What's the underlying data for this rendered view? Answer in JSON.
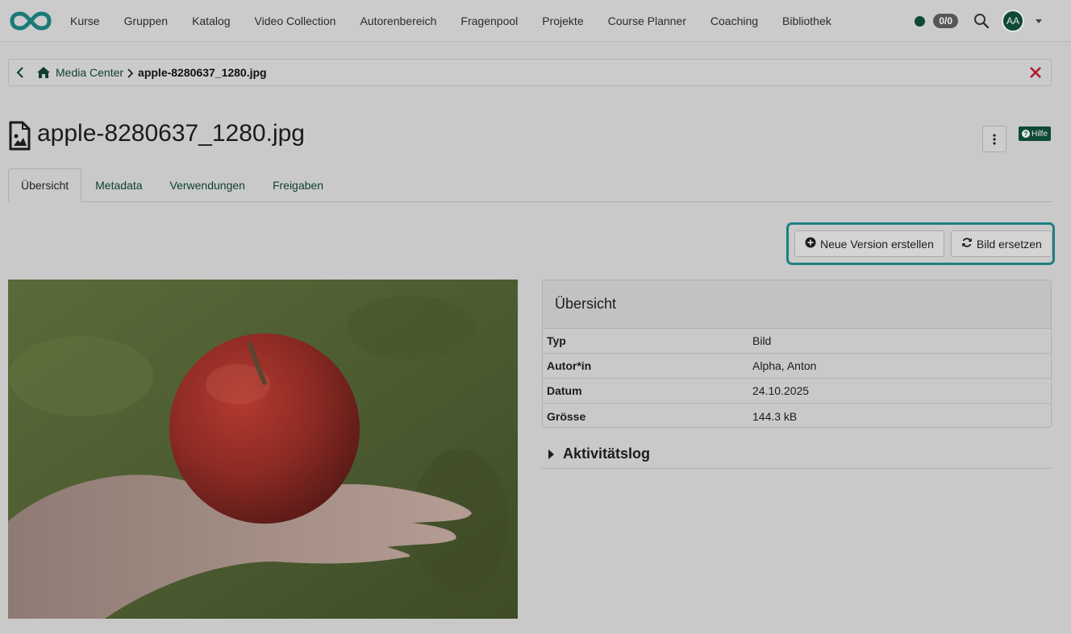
{
  "nav": {
    "items": [
      "Kurse",
      "Gruppen",
      "Katalog",
      "Video Collection",
      "Autorenbereich",
      "Fragenpool",
      "Projekte",
      "Course Planner",
      "Coaching",
      "Bibliothek"
    ],
    "count": "0/0",
    "avatar_initials": "AA"
  },
  "breadcrumb": {
    "parent": "Media Center",
    "current": "apple-8280637_1280.jpg"
  },
  "page": {
    "title": "apple-8280637_1280.jpg",
    "help_label": "Hilfe"
  },
  "tabs": [
    "Übersicht",
    "Metadata",
    "Verwendungen",
    "Freigaben"
  ],
  "actions": {
    "new_version": "Neue Version erstellen",
    "replace_image": "Bild ersetzen"
  },
  "overview": {
    "heading": "Übersicht",
    "rows": [
      {
        "key": "Typ",
        "value": "Bild"
      },
      {
        "key": "Autor*in",
        "value": "Alpha, Anton"
      },
      {
        "key": "Datum",
        "value": "24.10.2025"
      },
      {
        "key": "Grösse",
        "value": "144.3 kB"
      }
    ]
  },
  "activity_log": "Aktivitätslog",
  "colors": {
    "accent": "#0e4a33",
    "highlight": "#1e7f82",
    "close": "#b0192f"
  }
}
